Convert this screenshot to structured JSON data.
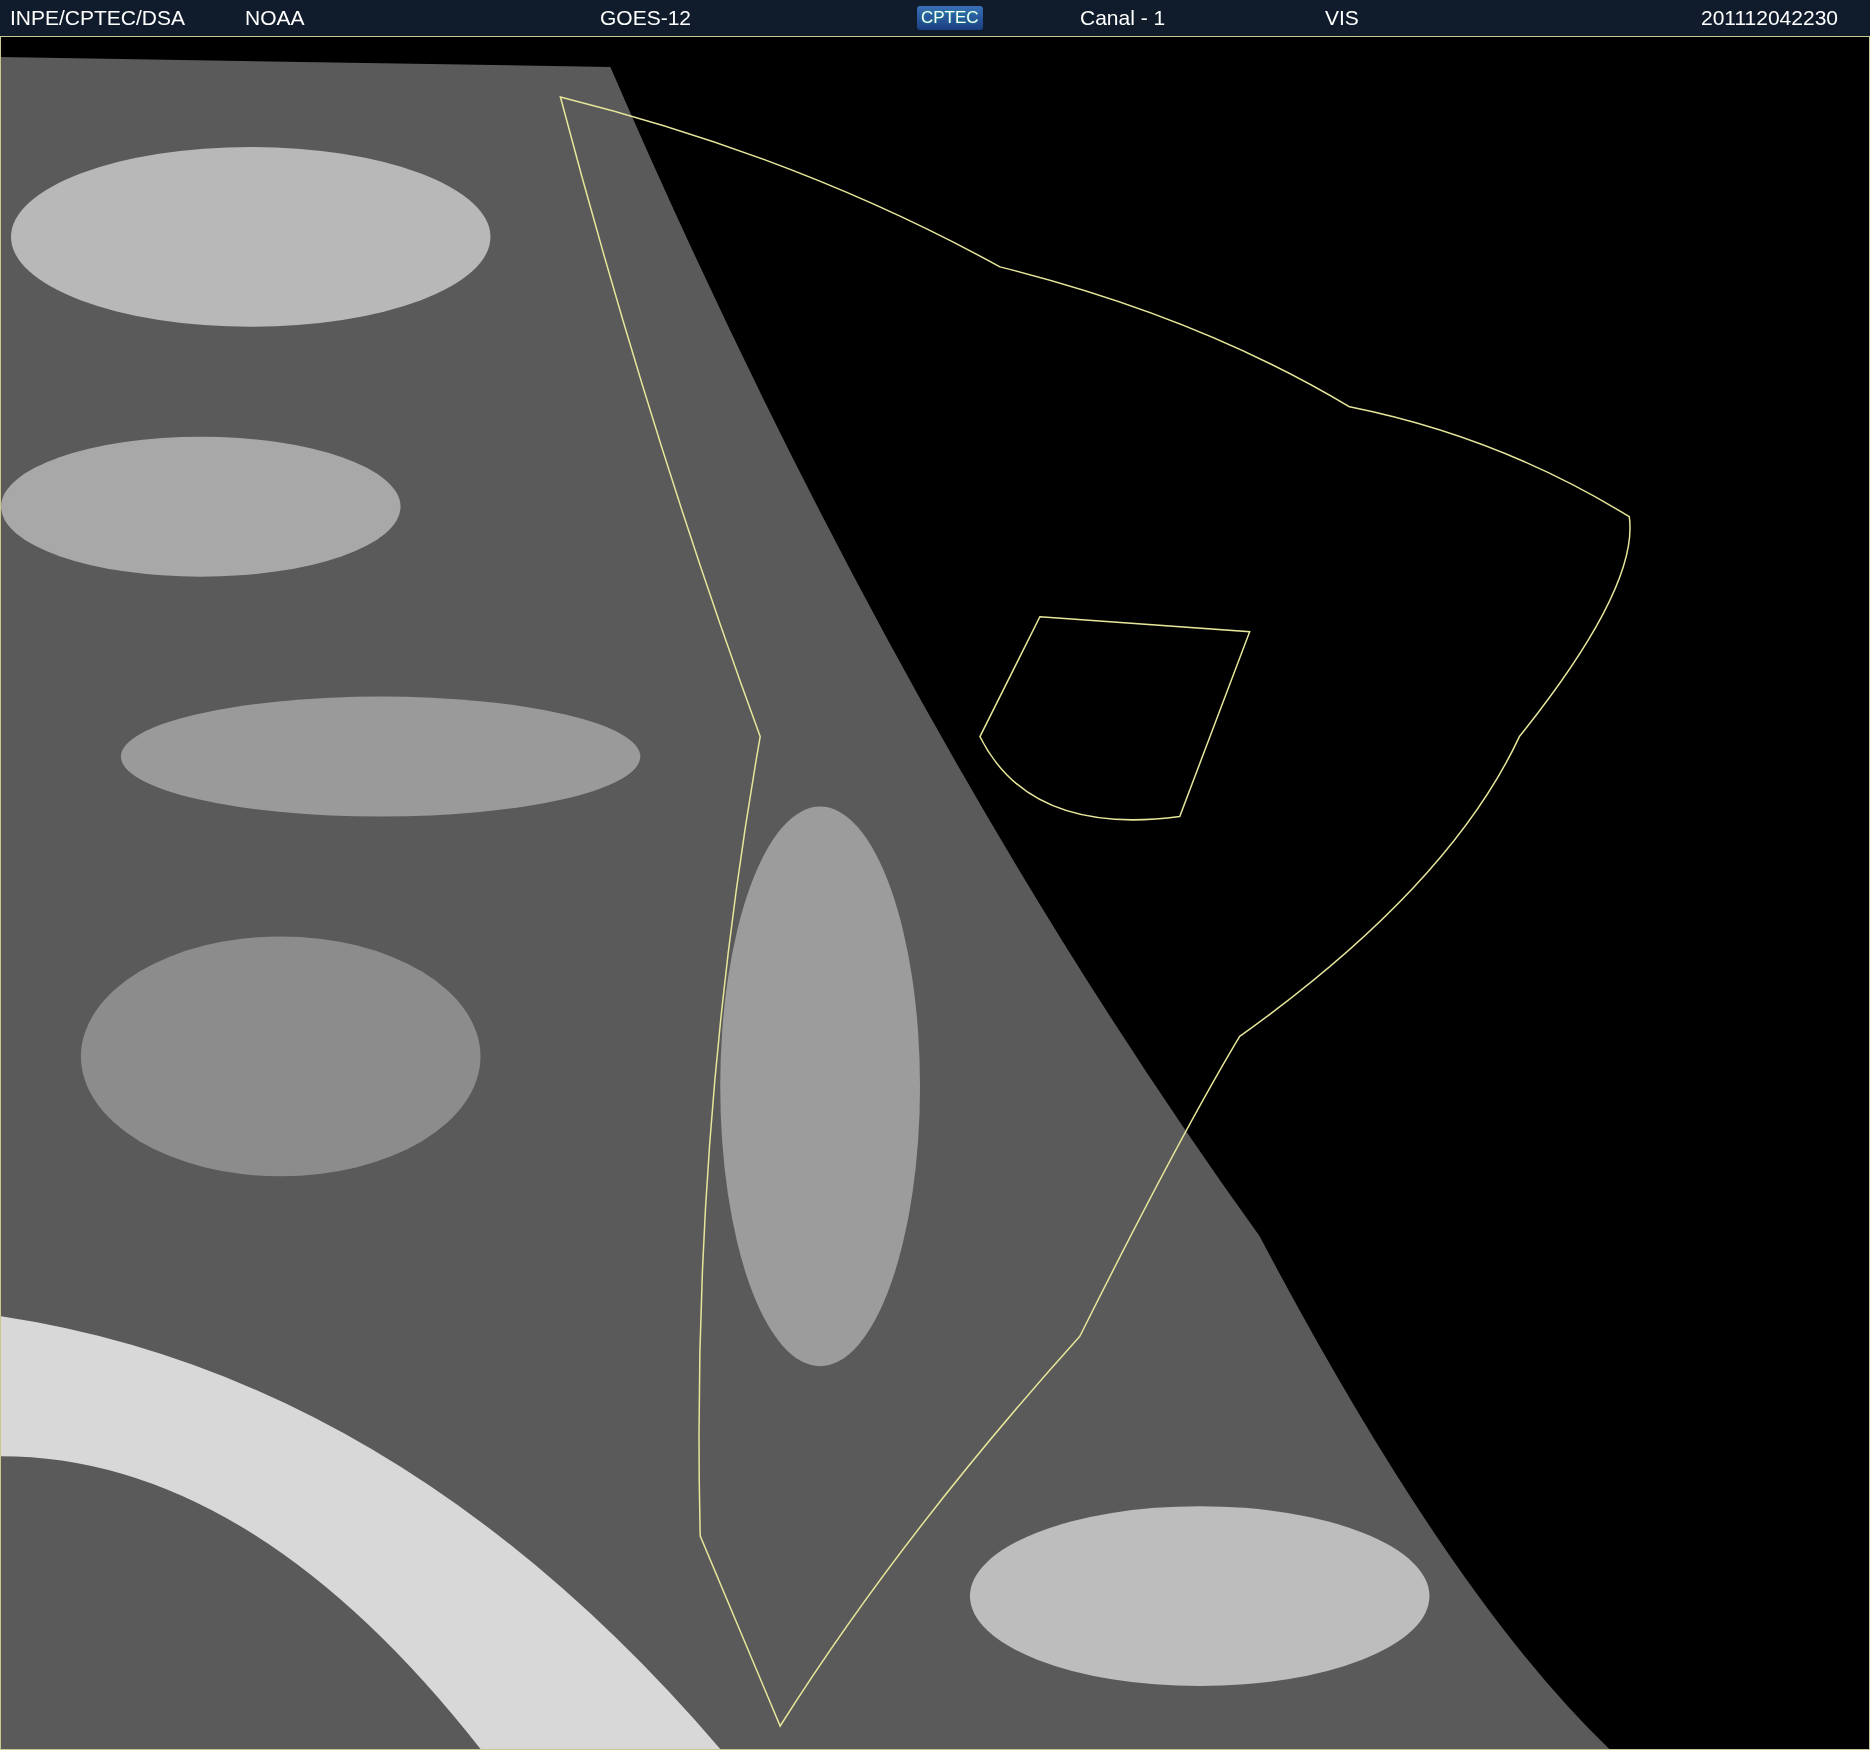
{
  "header": {
    "source": "INPE/CPTEC/DSA",
    "agency": "NOAA",
    "satellite": "GOES-12",
    "logo": "CPTEC",
    "channel": "Canal - 1",
    "band": "VIS",
    "timestamp": "201112042230"
  }
}
